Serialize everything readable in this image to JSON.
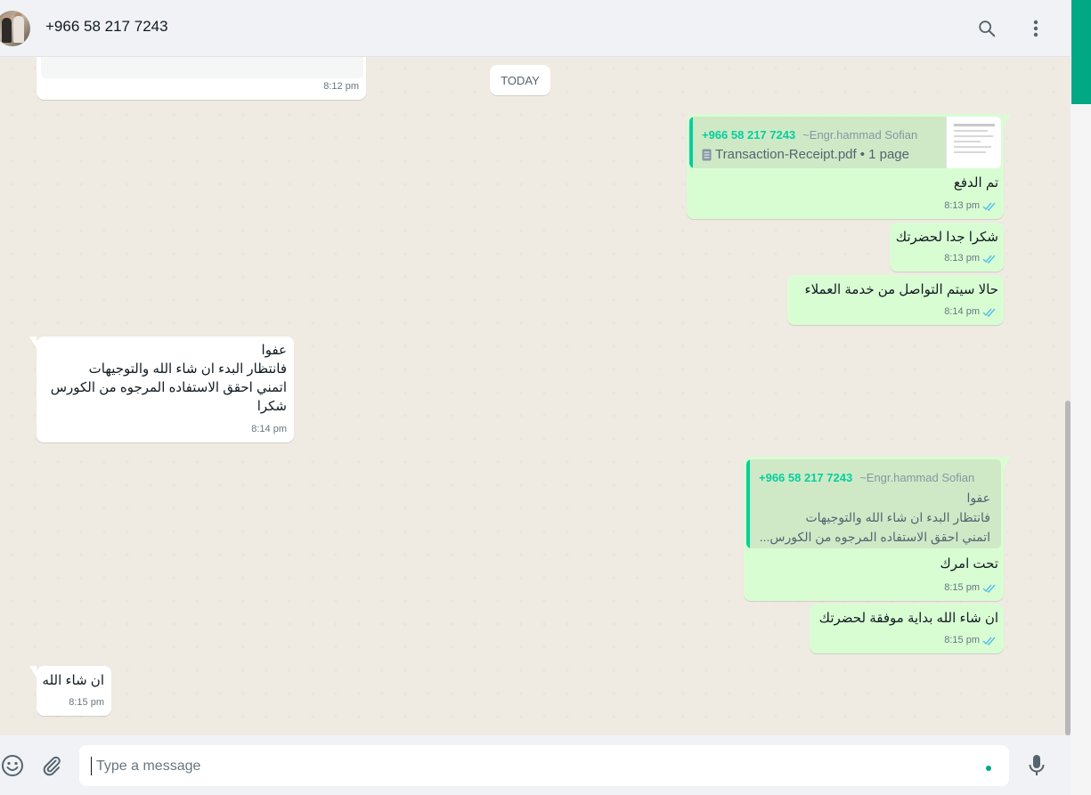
{
  "header": {
    "contact": "+966 58 217 7243"
  },
  "chat": {
    "day_badge": "TODAY",
    "messages": [
      {
        "time": "8:12 pm"
      },
      {
        "quote_phone": "+966 58 217 7243",
        "quote_alias": "~Engr.hammad Sofian",
        "file_name": "Transaction-Receipt.pdf",
        "file_info": "• 1 page",
        "text": "تم الدفع",
        "time": "8:13 pm"
      },
      {
        "text": "شكرا جدا لحضرتك",
        "time": "8:13 pm"
      },
      {
        "text": "حالا سيتم التواصل من خدمة العملاء",
        "time": "8:14 pm"
      },
      {
        "lines": [
          "عفوا",
          "فانتظار البدء ان شاء الله والتوجيهات",
          "اتمني احقق الاستفاده المرجوه من الكورس",
          "شكرا"
        ],
        "time": "8:14 pm"
      },
      {
        "quote_phone": "+966 58 217 7243",
        "quote_alias": "~Engr.hammad Sofian",
        "quote_lines": [
          "عفوا",
          "فانتظار البدء ان شاء الله والتوجيهات",
          "اتمني احقق الاستفاده المرجوه من الكورس..."
        ],
        "text": "تحت امرك",
        "time": "8:15 pm"
      },
      {
        "text": "ان شاء الله بداية موفقة لحضرتك",
        "time": "8:15 pm"
      },
      {
        "text": "ان شاء الله",
        "time": "8:15 pm"
      }
    ]
  },
  "footer": {
    "placeholder": "Type a message"
  },
  "icons": {
    "search": "search-icon",
    "menu": "kebab-menu-icon",
    "emoji": "emoji-icon",
    "attach": "paperclip-icon",
    "mic": "microphone-icon",
    "ticks": "double-check-icon",
    "doc": "document-icon"
  },
  "colors": {
    "accent": "#00a884",
    "outgoing": "#d9fdd3",
    "incoming": "#ffffff",
    "read_ticks": "#53bdeb"
  }
}
